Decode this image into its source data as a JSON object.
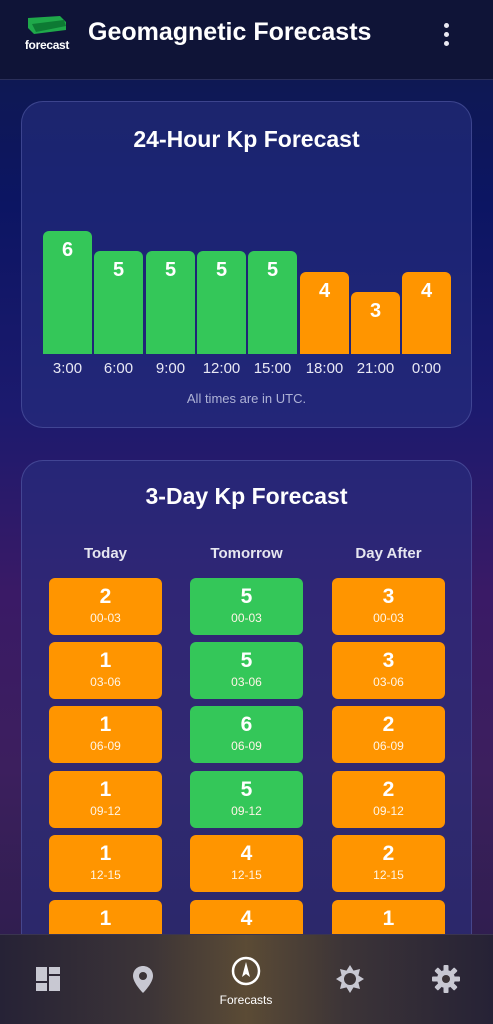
{
  "app": {
    "title": "Geomagnetic Forecasts",
    "logo_text": "forecast",
    "menu_icon": "more-vert-icon"
  },
  "hourly": {
    "title": "24-Hour Kp Forecast",
    "note": "All times are in UTC.",
    "bars": [
      {
        "time": "3:00",
        "kp": "6",
        "level": "green"
      },
      {
        "time": "6:00",
        "kp": "5",
        "level": "green"
      },
      {
        "time": "9:00",
        "kp": "5",
        "level": "green"
      },
      {
        "time": "12:00",
        "kp": "5",
        "level": "green"
      },
      {
        "time": "15:00",
        "kp": "5",
        "level": "green"
      },
      {
        "time": "18:00",
        "kp": "4",
        "level": "orange"
      },
      {
        "time": "21:00",
        "kp": "3",
        "level": "orange"
      },
      {
        "time": "0:00",
        "kp": "4",
        "level": "orange"
      }
    ]
  },
  "daily": {
    "title": "3-Day Kp Forecast",
    "columns": [
      {
        "label": "Today",
        "cells": [
          {
            "kp": "2",
            "range": "00-03",
            "level": "orange"
          },
          {
            "kp": "1",
            "range": "03-06",
            "level": "orange"
          },
          {
            "kp": "1",
            "range": "06-09",
            "level": "orange"
          },
          {
            "kp": "1",
            "range": "09-12",
            "level": "orange"
          },
          {
            "kp": "1",
            "range": "12-15",
            "level": "orange"
          },
          {
            "kp": "1",
            "range": "",
            "level": "orange"
          }
        ]
      },
      {
        "label": "Tomorrow",
        "cells": [
          {
            "kp": "5",
            "range": "00-03",
            "level": "green"
          },
          {
            "kp": "5",
            "range": "03-06",
            "level": "green"
          },
          {
            "kp": "6",
            "range": "06-09",
            "level": "green"
          },
          {
            "kp": "5",
            "range": "09-12",
            "level": "green"
          },
          {
            "kp": "4",
            "range": "12-15",
            "level": "orange"
          },
          {
            "kp": "4",
            "range": "",
            "level": "orange"
          }
        ]
      },
      {
        "label": "Day After",
        "cells": [
          {
            "kp": "3",
            "range": "00-03",
            "level": "orange"
          },
          {
            "kp": "3",
            "range": "03-06",
            "level": "orange"
          },
          {
            "kp": "2",
            "range": "06-09",
            "level": "orange"
          },
          {
            "kp": "2",
            "range": "09-12",
            "level": "orange"
          },
          {
            "kp": "2",
            "range": "12-15",
            "level": "orange"
          },
          {
            "kp": "1",
            "range": "",
            "level": "orange"
          }
        ]
      }
    ]
  },
  "colors": {
    "green": "#34c759",
    "orange": "#ff9500",
    "background_top": "#0c1563",
    "background_bottom": "#3c1f5e"
  },
  "nav": [
    {
      "icon": "dashboard-icon",
      "label": "",
      "active": false
    },
    {
      "icon": "location-pin-icon",
      "label": "",
      "active": false
    },
    {
      "icon": "compass-icon",
      "label": "Forecasts",
      "active": true
    },
    {
      "icon": "sun-icon",
      "label": "",
      "active": false
    },
    {
      "icon": "settings-gear-icon",
      "label": "",
      "active": false
    }
  ]
}
